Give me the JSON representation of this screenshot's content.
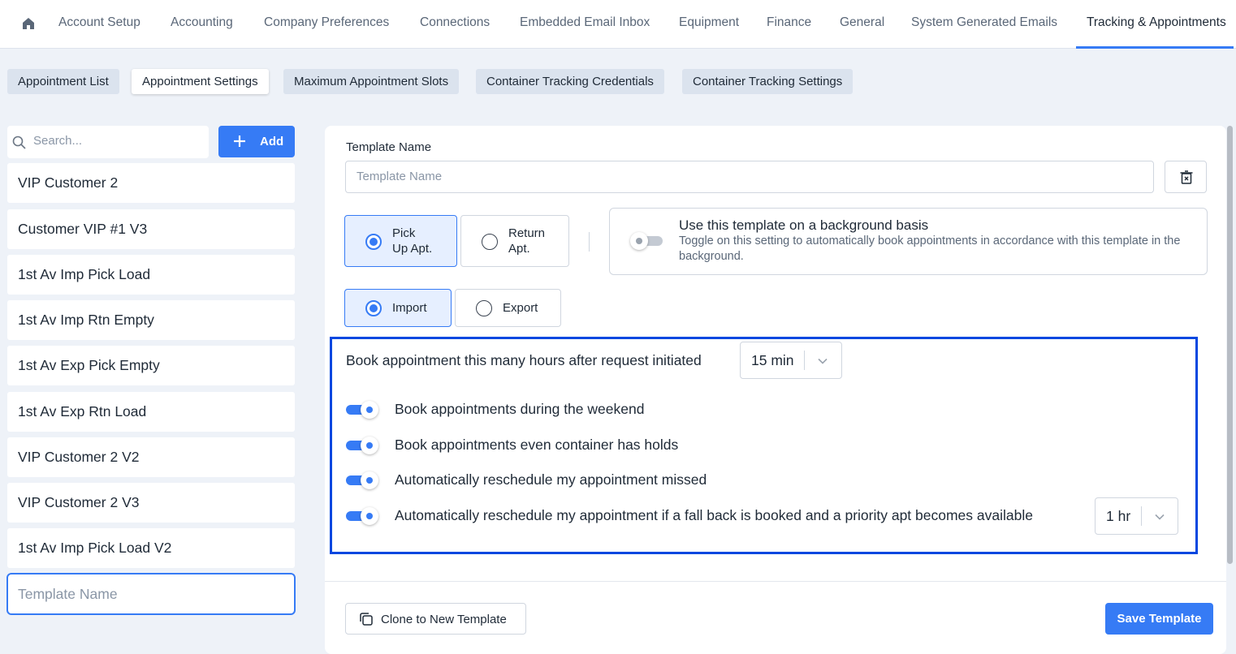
{
  "nav": {
    "home_icon": "home-icon",
    "tabs": [
      "Account Setup",
      "Accounting",
      "Company Preferences",
      "Connections",
      "Embedded Email Inbox",
      "Equipment",
      "Finance",
      "General",
      "System Generated Emails",
      "Tracking & Appointments"
    ],
    "active_tab": "Tracking & Appointments"
  },
  "subtabs": [
    "Appointment List",
    "Appointment Settings",
    "Maximum Appointment Slots",
    "Container Tracking Credentials",
    "Container Tracking Settings"
  ],
  "active_subtab": "Appointment Settings",
  "sidebar": {
    "search_placeholder": "Search...",
    "add_label": "Add",
    "items": [
      "VIP Customer 2",
      "Customer VIP #1 V3",
      "1st Av Imp Pick Load",
      "1st Av Imp Rtn Empty",
      "1st Av Exp Pick Empty",
      "1st Av Exp Rtn Load",
      "VIP Customer 2 V2",
      "VIP Customer 2 V3",
      "1st Av Imp Pick Load V2"
    ],
    "new_template_placeholder": "Template Name"
  },
  "form": {
    "template_name_label": "Template Name",
    "template_name_placeholder": "Template Name",
    "appointment_type": {
      "options": [
        "Pick\nUp Apt.",
        "Return\nApt."
      ],
      "selected": "Pick Up Apt."
    },
    "move_type": {
      "options": [
        "Import",
        "Export"
      ],
      "selected": "Import"
    },
    "background": {
      "title": "Use this template on a background basis",
      "description": "Toggle on this setting to automatically book appointments in accordance with this template in the background.",
      "enabled": false
    },
    "book_after_label": "Book appointment this many hours after request initiated",
    "book_after_value": "15 min",
    "toggles": [
      {
        "label": "Book appointments during the weekend",
        "on": true
      },
      {
        "label": "Book appointments even container has holds",
        "on": true
      },
      {
        "label": "Automatically reschedule my appointment missed",
        "on": true
      },
      {
        "label": "Automatically reschedule my appointment if a fall back is booked and a priority apt becomes available",
        "on": true
      }
    ],
    "priority_value": "1 hr",
    "clone_label": "Clone to New Template",
    "save_label": "Save Template"
  },
  "colors": {
    "accent": "#367bf5",
    "highlight_border": "#0047e0",
    "background": "#eef2f8"
  }
}
